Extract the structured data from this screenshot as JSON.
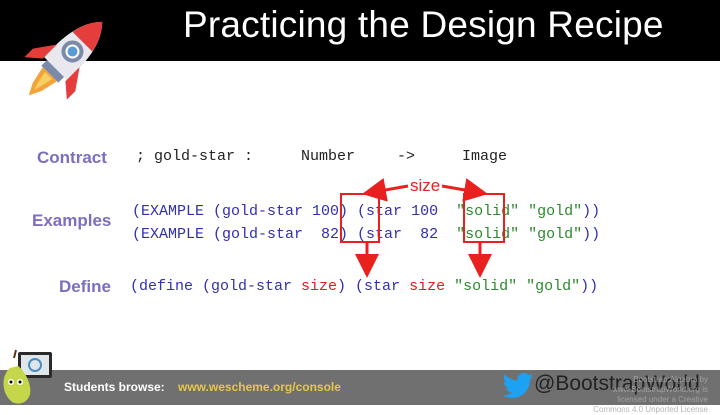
{
  "header": {
    "title": "Practicing the Design Recipe"
  },
  "labels": {
    "contract": "Contract",
    "examples": "Examples",
    "define": "Define"
  },
  "contract": {
    "name": "; gold-star :",
    "domain": "Number",
    "arrow": "->",
    "range": "Image"
  },
  "examples": [
    {
      "prefix": "(EXAMPLE (gold-star ",
      "input": "100",
      "mid": ") (star ",
      "output": "100",
      "mode": "\"solid\"",
      "color": "\"gold\"",
      "end": "))"
    },
    {
      "prefix": "(EXAMPLE (gold-star ",
      "input": " 82",
      "mid": ") (star ",
      "output": " 82",
      "mode": "\"solid\"",
      "color": "\"gold\"",
      "end": "))"
    }
  ],
  "define": {
    "prefix": "(define (gold-star ",
    "param": "size",
    "mid": ") (star ",
    "param2": "size",
    "mode": "\"solid\"",
    "color": "\"gold\"",
    "end": "))"
  },
  "annotation": {
    "size_label": "size"
  },
  "footer": {
    "browse_label": "Students browse:",
    "browse_link": "www.wescheme.org/console",
    "twitter_handle": "@BootstrapWorld",
    "license": "Bootstrap:Algebra by www.BootstrapWorld.org is licensed under a Creative Commons 4.0 Unported License"
  },
  "colors": {
    "accent": "#7b6fbf",
    "code_blue": "#3030b0",
    "highlight_red": "#e8211f",
    "string_green": "#2c8a2c",
    "link_yellow": "#e6c64a"
  },
  "icons": [
    "rocket-icon",
    "twitter-bird-icon",
    "pear-mascot-icon"
  ]
}
